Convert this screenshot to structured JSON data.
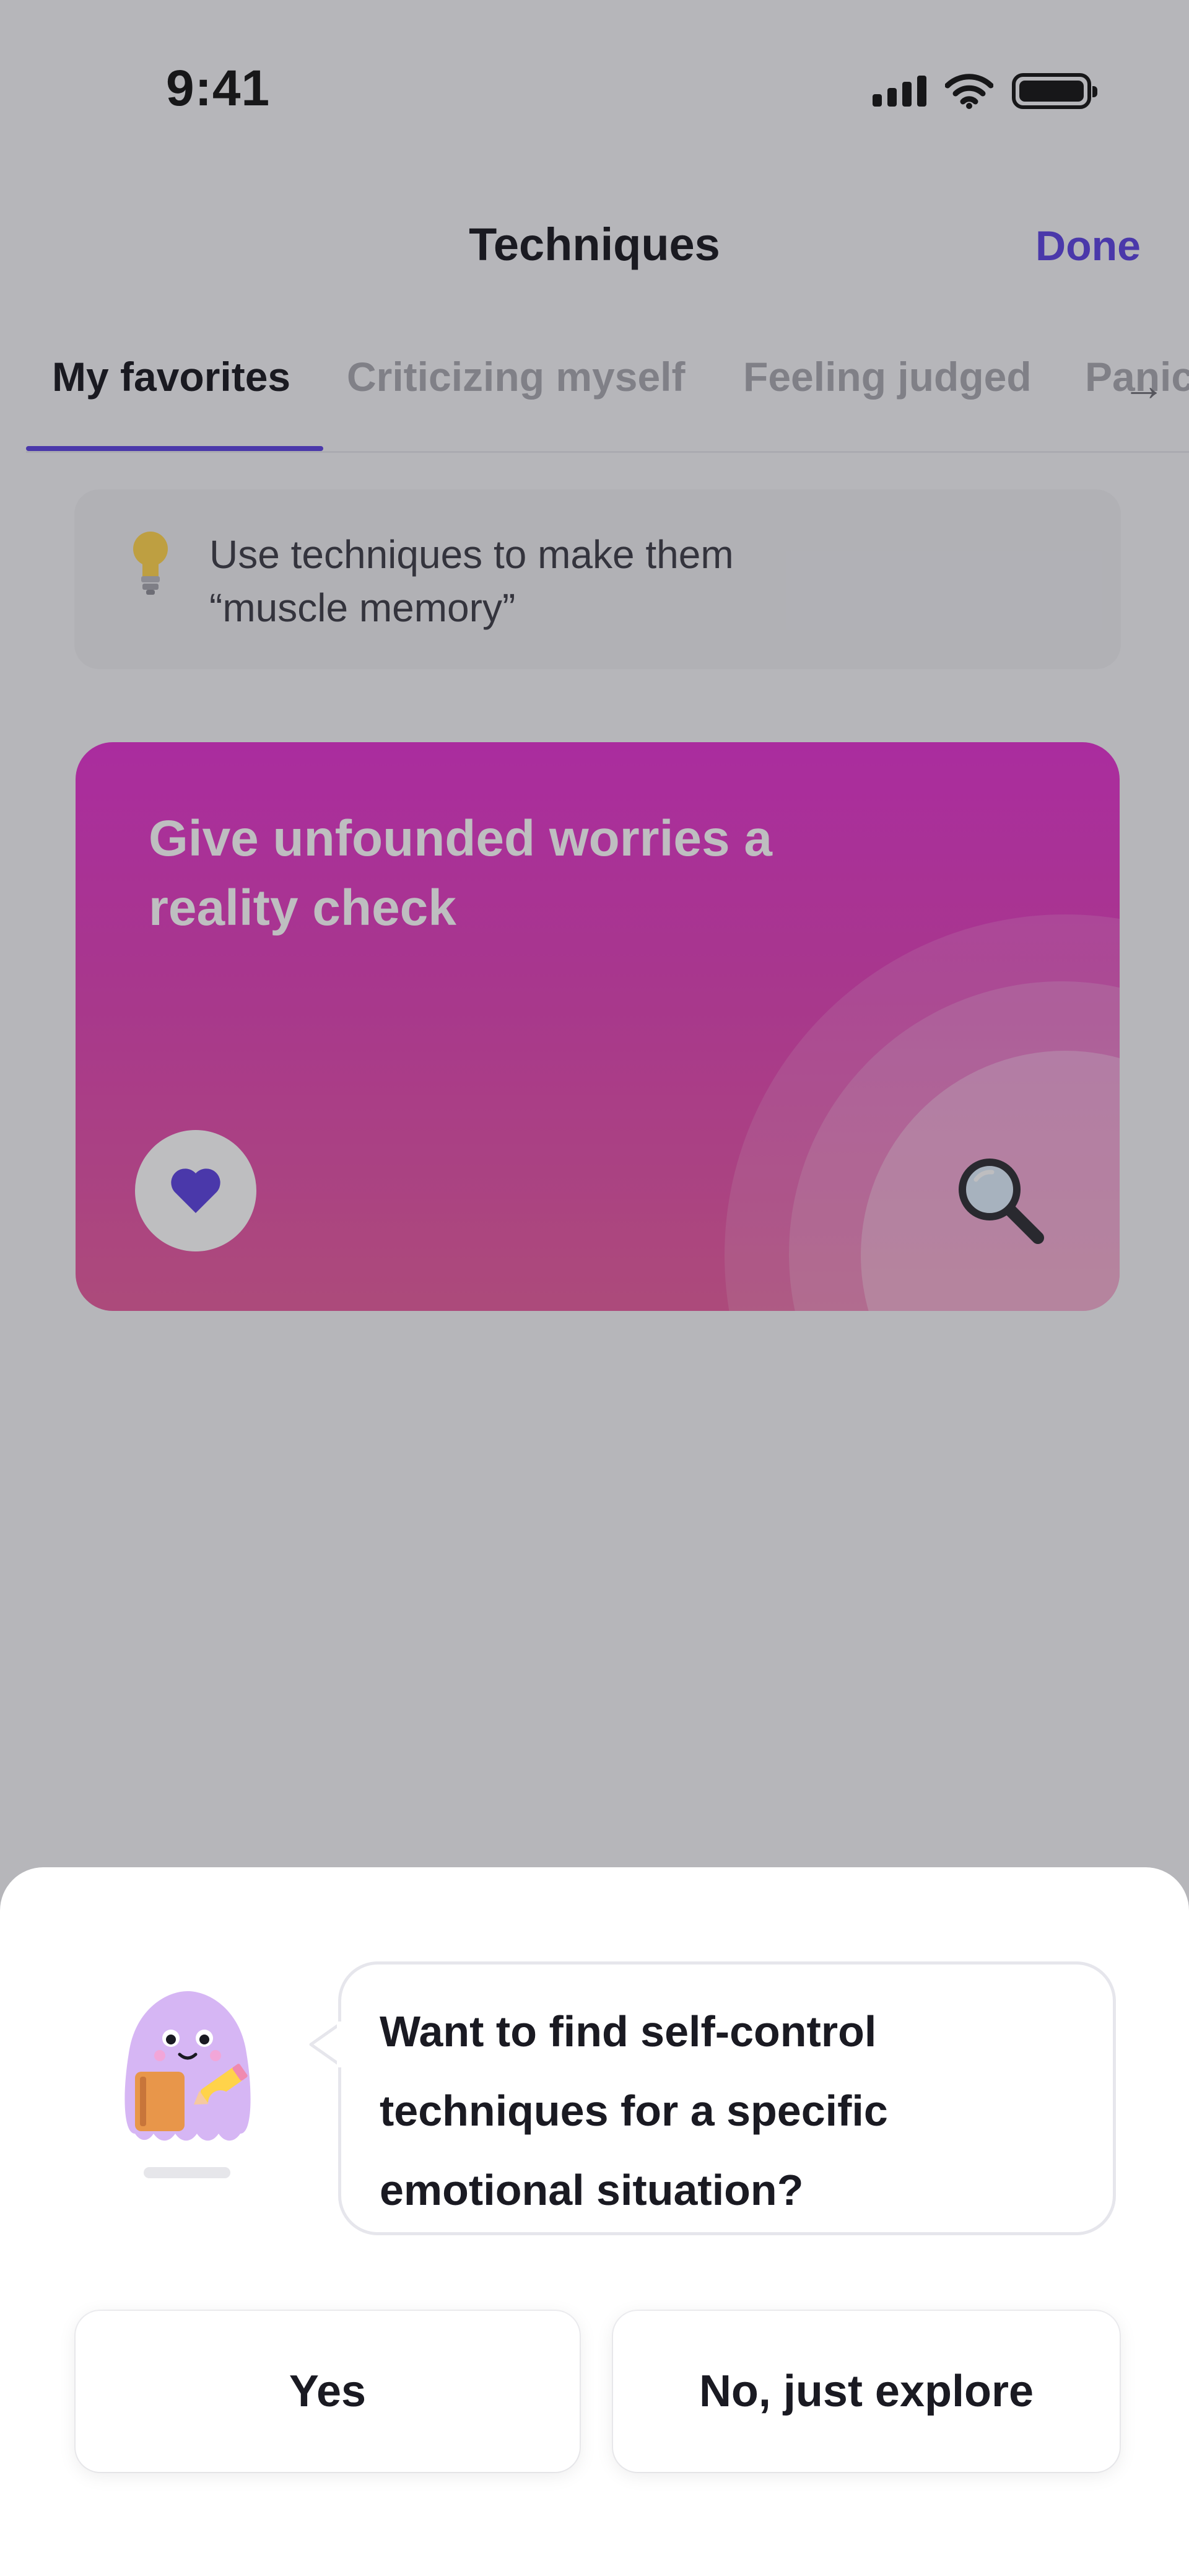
{
  "status_bar": {
    "time": "9:41"
  },
  "header": {
    "title": "Techniques",
    "done_label": "Done"
  },
  "tabs": [
    {
      "label": "My favorites",
      "active": true
    },
    {
      "label": "Criticizing myself",
      "active": false
    },
    {
      "label": "Feeling judged",
      "active": false
    },
    {
      "label": "Panic",
      "active": false
    }
  ],
  "tip": {
    "text": "Use techniques to make them\n“muscle memory”",
    "icon": "lightbulb-icon"
  },
  "card": {
    "title": "Give unfounded worries a reality check",
    "icon": "magnifying-glass-icon",
    "favorited": true,
    "accent": "#5a3fe0"
  },
  "sheet": {
    "question": "Want to find self-control techniques for a specific emotional situation?",
    "yes_label": "Yes",
    "no_label": "No, just explore"
  },
  "colors": {
    "accent": "#5a3fe0",
    "card_gradient_top": "#e22fcf",
    "card_gradient_bottom": "#e65a9c",
    "mascot": "#d6b6f4"
  }
}
